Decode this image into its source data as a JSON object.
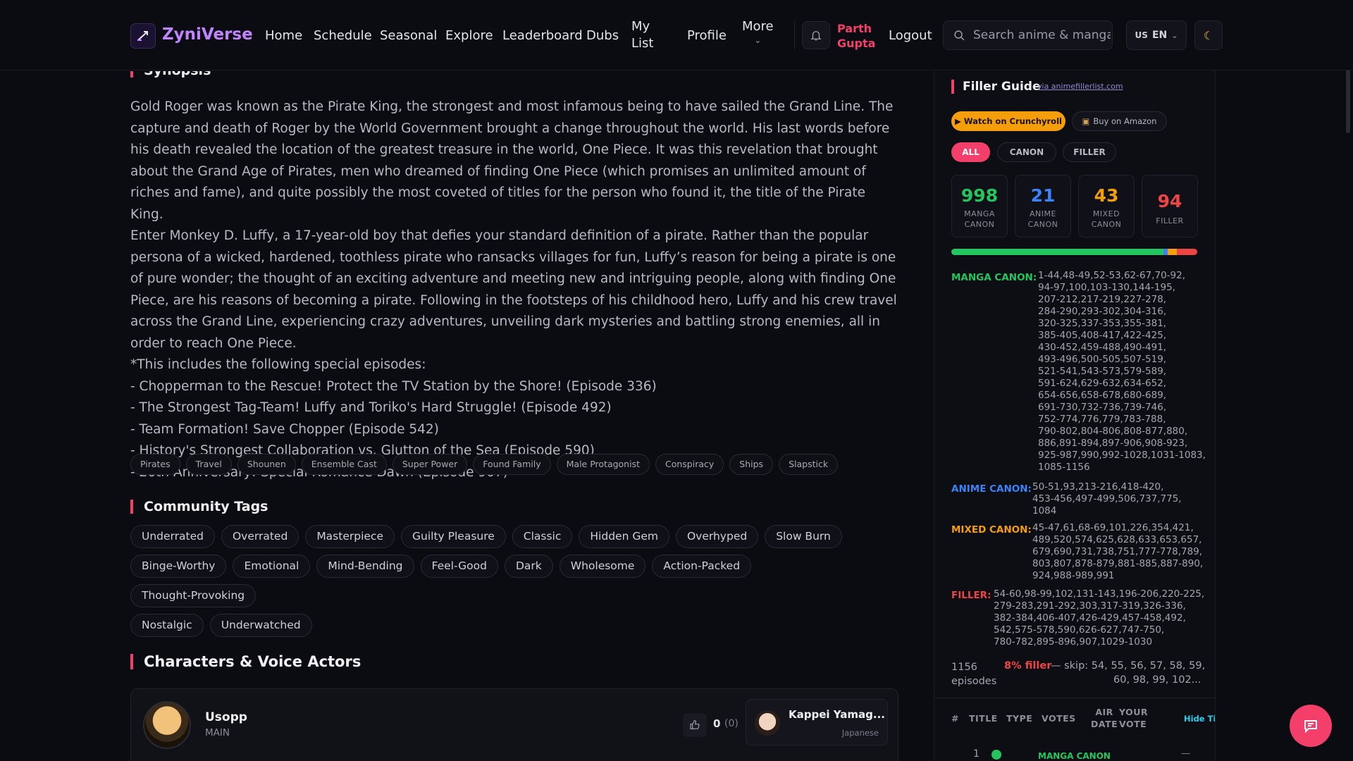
{
  "app": {
    "name": "ZyniVerse"
  },
  "nav": {
    "items": [
      "Home",
      "Schedule",
      "Seasonal",
      "Explore",
      "Leaderboard",
      "Dubs"
    ],
    "my_list_line1": "My",
    "my_list_line2": "List",
    "profile": "Profile",
    "more": "More",
    "user_first": "Parth",
    "user_last": "Gupta",
    "logout": "Logout",
    "search_placeholder": "Search anime & manga",
    "lang_flag": "US",
    "lang_code": "EN"
  },
  "synopsis": {
    "title": "Synopsis",
    "paragraphs": [
      "Gold Roger was known as the Pirate King, the strongest and most infamous being to have sailed the Grand Line. The capture and death of Roger by the World Government brought a change throughout the world. His last words before his death revealed the location of the greatest treasure in the world, One Piece. It was this revelation that brought about the Grand Age of Pirates, men who dreamed of finding One Piece (which promises an unlimited amount of riches and fame), and quite possibly the most coveted of titles for the person who found it, the title of the Pirate King.",
      "Enter Monkey D. Luffy, a 17-year-old boy that defies your standard definition of a pirate. Rather than the popular persona of a wicked, hardened, toothless pirate who ransacks villages for fun, Luffy’s reason for being a pirate is one of pure wonder; the thought of an exciting adventure and meeting new and intriguing people, along with finding One Piece, are his reasons of becoming a pirate. Following in the footsteps of his childhood hero, Luffy and his crew travel across the Grand Line, experiencing crazy adventures, unveiling dark mysteries and battling strong enemies, all in order to reach One Piece.",
      "*This includes the following special episodes:",
      "- Chopperman to the Rescue! Protect the TV Station by the Shore! (Episode 336)",
      "- The Strongest Tag-Team! Luffy and Toriko's Hard Struggle! (Episode 492)",
      "- Team Formation! Save Chopper (Episode 542)",
      "- History's Strongest Collaboration vs. Glutton of the Sea (Episode 590)",
      "- 20th Anniversary! Special Romance Dawn (Episode 907)"
    ]
  },
  "genre_tags": [
    "Pirates",
    "Travel",
    "Shounen",
    "Ensemble Cast",
    "Super Power",
    "Found Family",
    "Male Protagonist",
    "Conspiracy",
    "Ships",
    "Slapstick"
  ],
  "community": {
    "title": "Community Tags",
    "tags": [
      "Underrated",
      "Overrated",
      "Masterpiece",
      "Guilty Pleasure",
      "Classic",
      "Hidden Gem",
      "Overhyped",
      "Slow Burn",
      "Binge-Worthy",
      "Emotional",
      "Mind-Bending",
      "Feel-Good",
      "Dark",
      "Wholesome",
      "Action-Packed",
      "Thought-Provoking",
      "Nostalgic",
      "Underwatched"
    ]
  },
  "characters": {
    "title": "Characters & Voice Actors",
    "first": {
      "name": "Usopp",
      "role": "MAIN",
      "votes": "0",
      "votes_count": "(0)",
      "va_name": "Kappei Yamag...",
      "va_lang": "Japanese"
    }
  },
  "filler": {
    "title": "Filler Guide",
    "source": "via animefillerlist.com",
    "crunchyroll": "Watch on Crunchyroll",
    "amazon": "Buy on Amazon",
    "filters": [
      "ALL",
      "CANON",
      "FILLER"
    ],
    "active_filter": "ALL",
    "stats": [
      {
        "value": "998",
        "label1": "MANGA",
        "label2": "CANON",
        "color": "#22c55e"
      },
      {
        "value": "21",
        "label1": "ANIME",
        "label2": "CANON",
        "color": "#3b82f6"
      },
      {
        "value": "43",
        "label1": "MIXED",
        "label2": "CANON",
        "color": "#f59e0b"
      },
      {
        "value": "94",
        "label1": "FILLER",
        "label2": "",
        "color": "#ef4444"
      }
    ],
    "bar_fractions": [
      0.863,
      0.018,
      0.037,
      0.081
    ],
    "manga_label": "MANGA CANON:",
    "manga_lines": [
      "1-44,48-49,52-53,62-67,70-92,",
      "94-97,100,103-130,144-195,",
      "207-212,217-219,227-278,",
      "284-290,293-302,304-316,",
      "320-325,337-353,355-381,",
      "385-405,408-417,422-425,",
      "430-452,459-488,490-491,",
      "493-496,500-505,507-519,",
      "521-541,543-573,579-589,",
      "591-624,629-632,634-652,",
      "654-656,658-678,680-689,",
      "691-730,732-736,739-746,",
      "752-774,776,779,783-788,",
      "790-802,804-806,808-877,880,",
      "886,891-894,897-906,908-923,",
      "925-987,990,992-1028,1031-1083,",
      "1085-1156"
    ],
    "anime_label": "ANIME CANON:",
    "anime_lines": [
      "50-51,93,213-216,418-420,",
      "453-456,497-499,506,737,775,",
      "1084"
    ],
    "mixed_label": "MIXED CANON:",
    "mixed_lines": [
      "45-47,61,68-69,101,226,354,421,",
      "489,520,574,625,628,633,653,657,",
      "679,690,731,738,751,777-778,789,",
      "803,807,878-879,881-885,887-890,",
      "924,988-989,991"
    ],
    "filler_label": "FILLER:",
    "filler_lines": [
      "54-60,98-99,102,131-143,196-206,220-225,",
      "279-283,291-292,303,317-319,326-336,",
      "382-384,406-407,426-429,457-458,492,",
      "542,575-578,590,626-627,747-750,",
      "780-782,895-896,907,1029-1030"
    ],
    "episodes_count": "1156",
    "episodes_word": "episodes",
    "filler_pct": "8% filler",
    "skip_line1": "— skip: 54, 55, 56, 57, 58, 59,",
    "skip_line2": "60, 98, 99, 102...",
    "table_headers": {
      "num": "#",
      "title": "TITLE",
      "type": "TYPE",
      "votes": "VOTES",
      "air1": "AIR",
      "air2": "DATE",
      "your1": "YOUR",
      "your2": "VOTE",
      "hide": "Hide Ti"
    },
    "first_row": {
      "num": "1",
      "type": "MANGA CANON",
      "vote": "—"
    }
  }
}
